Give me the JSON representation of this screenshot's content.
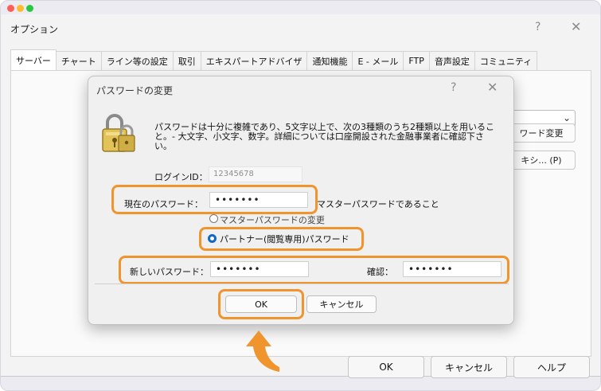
{
  "options_window": {
    "title": "オプション",
    "help_label": "?",
    "close_label": "✕",
    "tabs": [
      {
        "label": "サーバー",
        "active": true
      },
      {
        "label": "チャート",
        "active": false
      },
      {
        "label": "ライン等の設定",
        "active": false
      },
      {
        "label": "取引",
        "active": false
      },
      {
        "label": "エキスパートアドバイザ",
        "active": false
      },
      {
        "label": "通知機能",
        "active": false
      },
      {
        "label": "E - メール",
        "active": false
      },
      {
        "label": "FTP",
        "active": false
      },
      {
        "label": "音声設定",
        "active": false
      },
      {
        "label": "コミュニティ",
        "active": false
      }
    ],
    "background_buttons": {
      "change_password_partial": "ワード変更",
      "proxy_partial": "キシ... (P)"
    },
    "bottom_buttons": {
      "ok": "OK",
      "cancel": "キャンセル",
      "help": "ヘルプ"
    }
  },
  "dialog": {
    "title": "パスワードの変更",
    "help_label": "?",
    "close_label": "✕",
    "description": "パスワードは十分に複雑であり、5文字以上で、次の3種類のうち2種類以上を用いること。- 大文字、小文字、数字。詳細については口座開設された金融事業者に確認下さい。",
    "login_id_label": "ログインID：",
    "login_id_value": "12345678",
    "current_password_label": "現在のパスワード：",
    "current_password_value": "•••••••",
    "master_password_label": "マスターパスワードであること",
    "change_master_label": "マスターパスワードの変更",
    "partner_password_label": "パートナー(閲覧専用)パスワード",
    "new_password_label": "新しいパスワード：",
    "new_password_value": "•••••••",
    "confirm_label": "確認：",
    "confirm_value": "•••••••",
    "ok_label": "OK",
    "cancel_label": "キャンセル"
  },
  "colors": {
    "highlight": "#f0952d",
    "radio_selected": "#1466c9",
    "arrow": "#f0952d"
  },
  "icons": [
    "lock-icon",
    "arrow-up-icon",
    "chevron-down-icon",
    "close-icon",
    "help-icon"
  ]
}
